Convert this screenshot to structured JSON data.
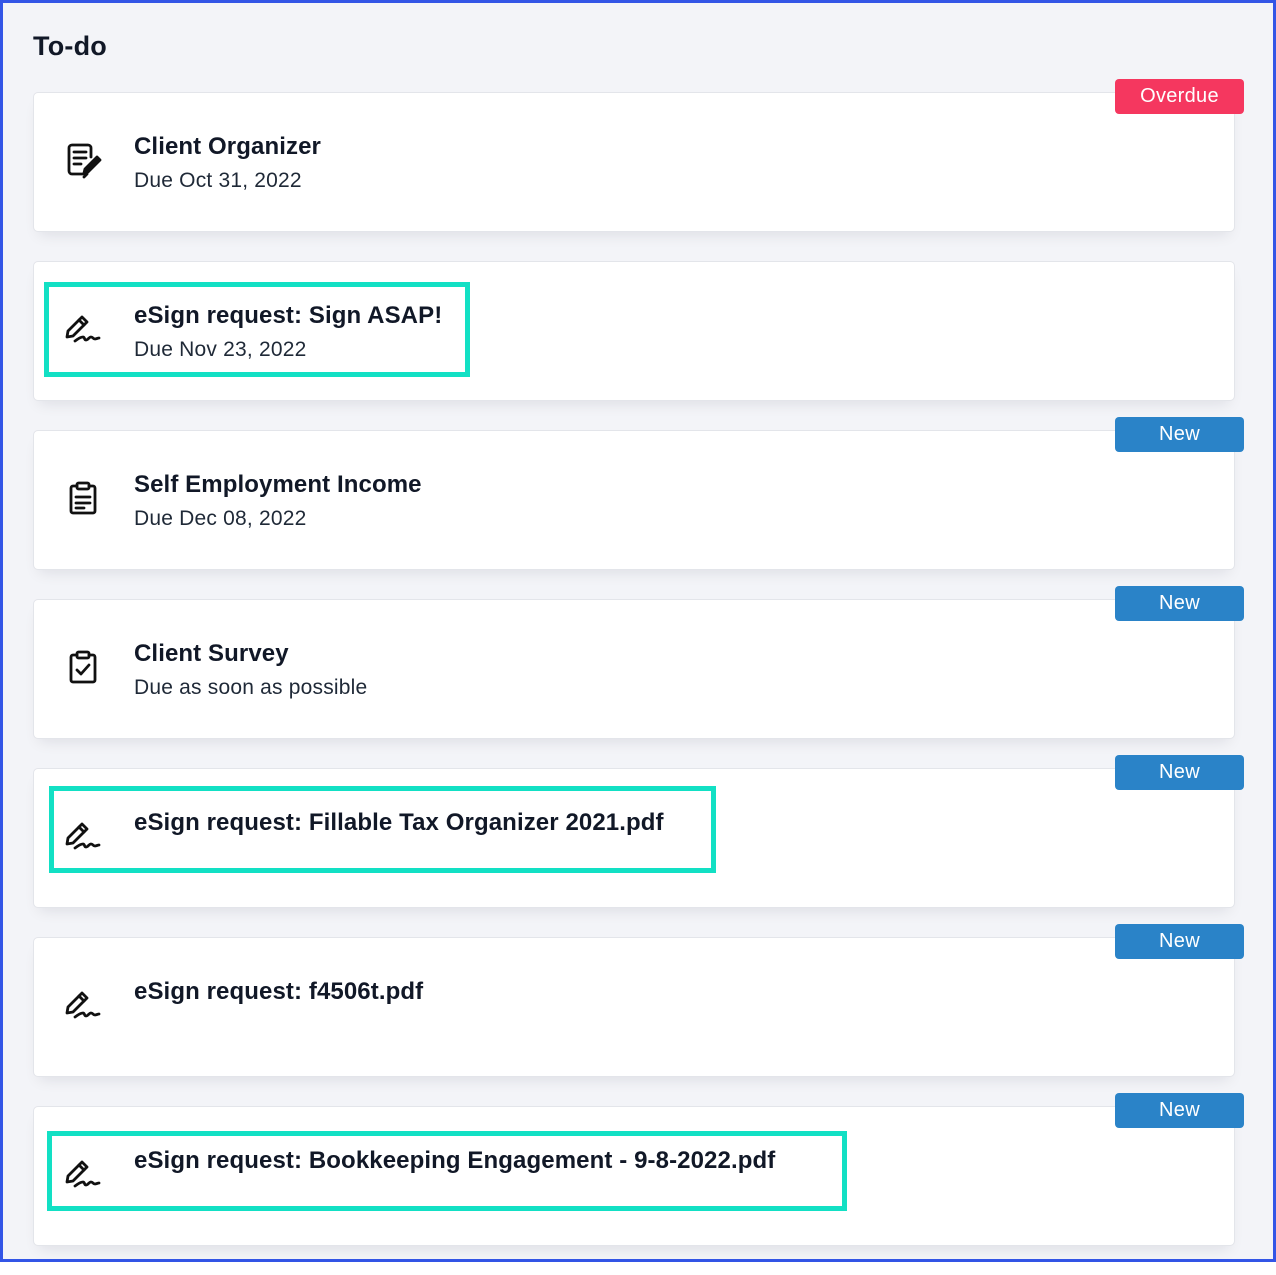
{
  "page": {
    "title": "To-do"
  },
  "colors": {
    "frame_border": "#3355e6",
    "background": "#f3f4f8",
    "overdue_badge": "#f5375f",
    "new_badge": "#2a83c8",
    "highlight": "#12e0c4"
  },
  "todos": [
    {
      "title": "Client Organizer",
      "due": "Due Oct 31, 2022",
      "icon": "organizer-icon",
      "badge": "Overdue",
      "highlighted": false
    },
    {
      "title": "eSign request: Sign ASAP!",
      "due": "Due Nov 23, 2022",
      "icon": "signature-icon",
      "badge": "",
      "highlighted": true
    },
    {
      "title": "Self Employment Income",
      "due": "Due Dec 08, 2022",
      "icon": "clipboard-icon",
      "badge": "New",
      "highlighted": false
    },
    {
      "title": "Client Survey",
      "due": "Due as soon as possible",
      "icon": "clipboard-check-icon",
      "badge": "New",
      "highlighted": false
    },
    {
      "title": "eSign request: Fillable Tax Organizer 2021.pdf",
      "due": "",
      "icon": "signature-icon",
      "badge": "New",
      "highlighted": true
    },
    {
      "title": "eSign request: f4506t.pdf",
      "due": "",
      "icon": "signature-icon",
      "badge": "New",
      "highlighted": false
    },
    {
      "title": "eSign request: Bookkeeping Engagement - 9-8-2022.pdf",
      "due": "",
      "icon": "signature-icon",
      "badge": "New",
      "highlighted": true
    }
  ]
}
